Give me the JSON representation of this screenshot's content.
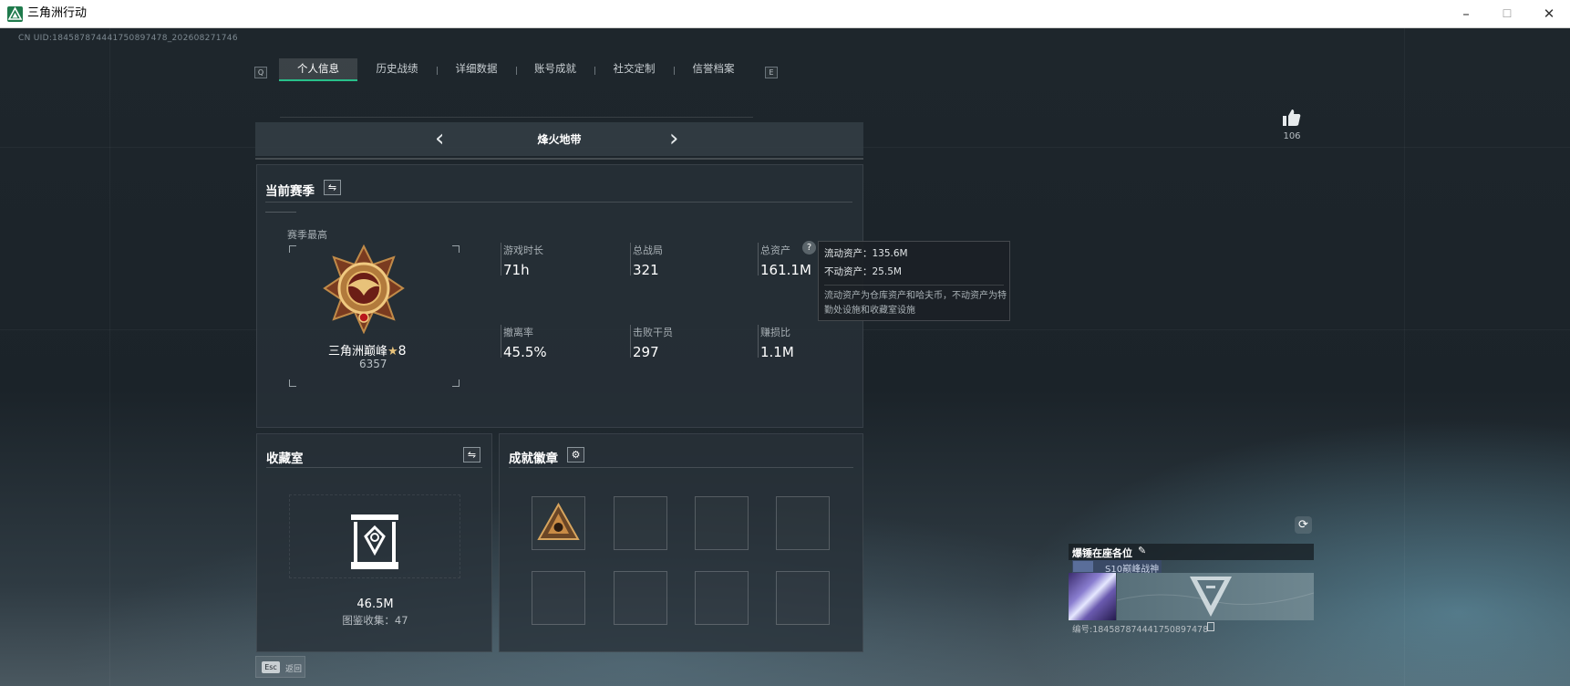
{
  "window": {
    "title": "三角洲行动",
    "minimize_glyph": "–",
    "maximize_glyph": "☐",
    "close_glyph": "✕"
  },
  "header": {
    "uid": "CN UID:18458787444175089747​8_20260827174​6"
  },
  "tabs": {
    "prev_key": "Q",
    "next_key": "E",
    "items": [
      {
        "label": "个人信息",
        "active": true
      },
      {
        "label": "历史战绩",
        "active": false
      },
      {
        "label": "详细数据",
        "active": false
      },
      {
        "label": "账号成就",
        "active": false
      },
      {
        "label": "社交定制",
        "active": false
      },
      {
        "label": "信誉档案",
        "active": false
      }
    ]
  },
  "mode": {
    "title": "烽火地带",
    "prev_glyph": "‹",
    "next_glyph": "›"
  },
  "season": {
    "title": "当前赛季",
    "switch_glyph": "⇋",
    "highest_label": "赛季最高",
    "rank_name": "三角洲巅峰",
    "rank_star_glyph": "★",
    "rank_level": "8",
    "rank_points": "6357",
    "stats": [
      {
        "label": "游戏时长",
        "value": "71h"
      },
      {
        "label": "总战局",
        "value": "321"
      },
      {
        "label": "总资产",
        "value": "161.1M",
        "help": "?"
      },
      {
        "label": "撤离率",
        "value": "45.5%"
      },
      {
        "label": "击败干员",
        "value": "297"
      },
      {
        "label": "赚损比",
        "value": "1.1M"
      }
    ]
  },
  "tooltip": {
    "liquid": "流动资产：135.6M",
    "fixed": "不动资产：25.5M",
    "desc": "流动资产为仓库资产和哈夫币，不动资产为特勤处设施和收藏室设施"
  },
  "collection": {
    "title": "收藏室",
    "switch_glyph": "⇋",
    "value": "46.5M",
    "count_label": "图鉴收集：47"
  },
  "achievements": {
    "title": "成就徽章",
    "settings_glyph": "⚙",
    "slots": 8
  },
  "likes": {
    "count": "106"
  },
  "player_card": {
    "refresh_glyph": "⟳",
    "name": "爆锤在座各位",
    "edit_glyph": "✎",
    "title_tag": "S10巅峰战神",
    "id_label": "编号:18458787444175089747​8"
  },
  "footer": {
    "esc_key": "Esc",
    "esc_label": "返回"
  },
  "colors": {
    "accent": "#28c08a",
    "panel": "#283138",
    "text": "#ffffff"
  }
}
